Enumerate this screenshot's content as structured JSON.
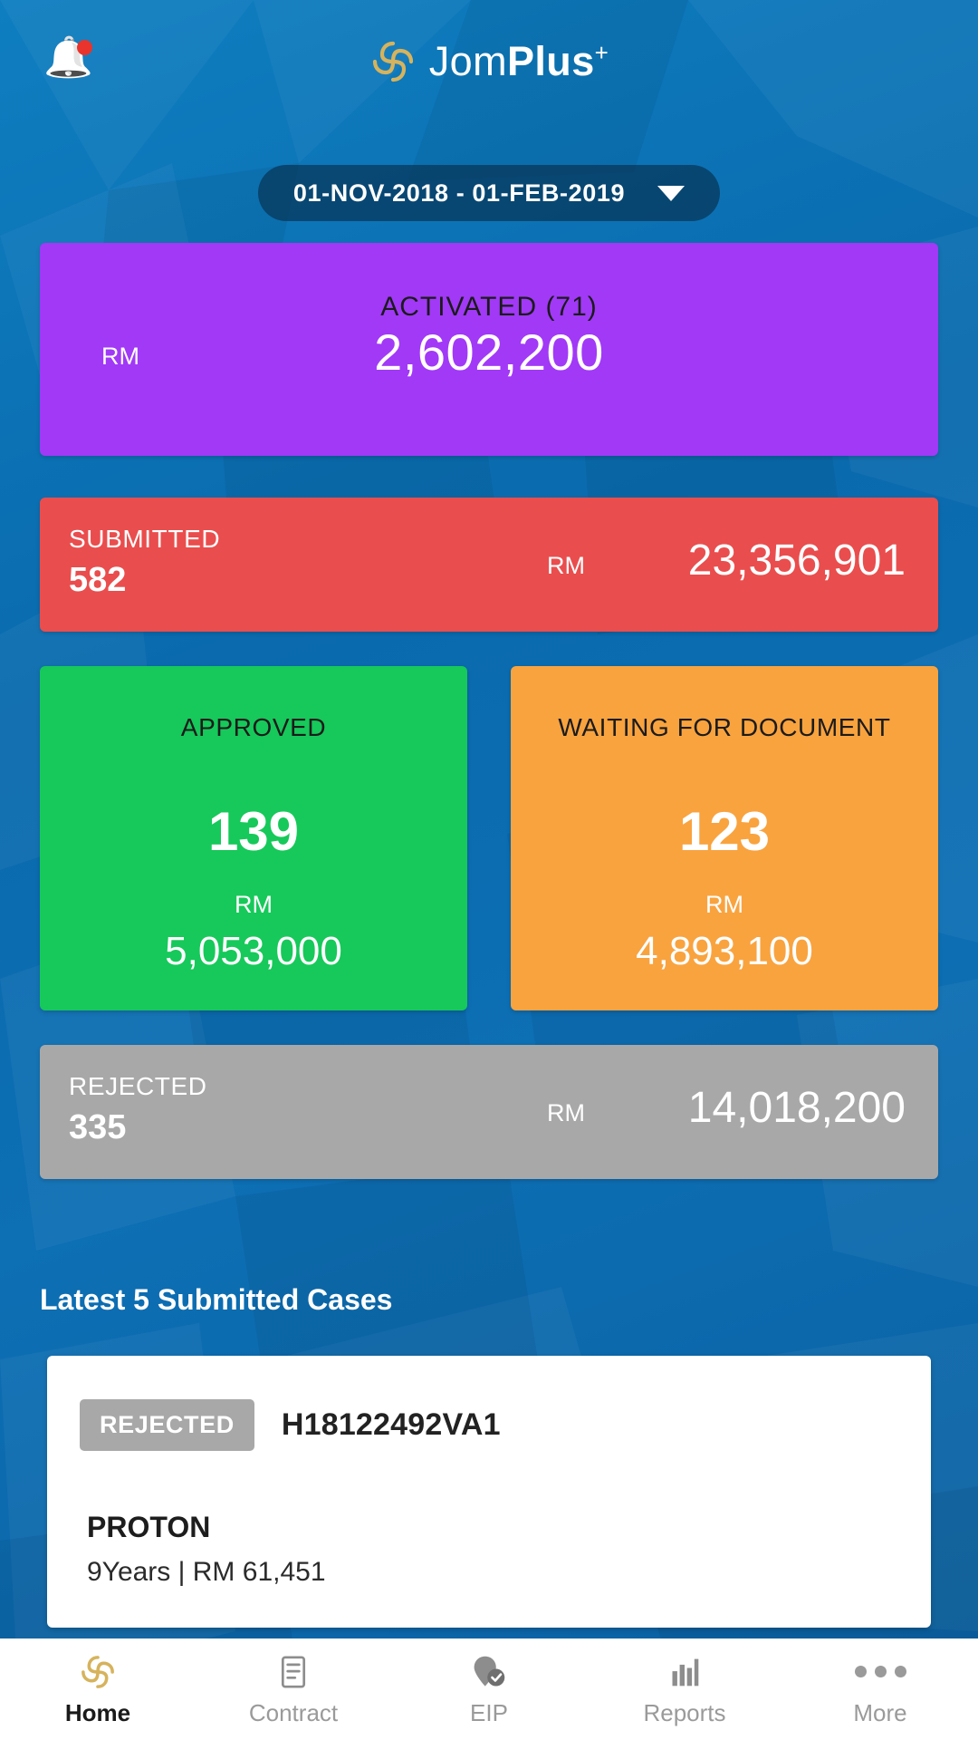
{
  "header": {
    "brand_prefix": "Jom",
    "brand_bold": "Plus",
    "brand_sup": "+",
    "notification_icon": "bell-icon",
    "logo_icon": "jomplus-logo-icon"
  },
  "date_filter": {
    "value": "01-NOV-2018 - 01-FEB-2019",
    "caret_icon": "chevron-down-icon"
  },
  "stats": {
    "activated": {
      "title": "ACTIVATED (71)",
      "currency": "RM",
      "amount": "2,602,200",
      "color": "#a139f7"
    },
    "submitted": {
      "title": "SUBMITTED",
      "count": "582",
      "currency": "RM",
      "amount": "23,356,901",
      "color": "#ea4d4d"
    },
    "approved": {
      "title": "APPROVED",
      "count": "139",
      "currency": "RM",
      "amount": "5,053,000",
      "color": "#16c95a"
    },
    "waiting": {
      "title": "WAITING FOR DOCUMENT",
      "count": "123",
      "currency": "RM",
      "amount": "4,893,100",
      "color": "#f9a33f"
    },
    "rejected": {
      "title": "REJECTED",
      "count": "335",
      "currency": "RM",
      "amount": "14,018,200",
      "color": "#a8a8a8"
    }
  },
  "latest": {
    "section_title": "Latest 5 Submitted Cases",
    "cases": [
      {
        "status": "REJECTED",
        "reference": "H18122492VA1",
        "brand": "PROTON",
        "details": "9Years | RM 61,451"
      }
    ]
  },
  "bottom_nav": {
    "items": [
      {
        "label": "Home",
        "icon": "jomplus-logo-icon",
        "active": true
      },
      {
        "label": "Contract",
        "icon": "document-icon",
        "active": false
      },
      {
        "label": "EIP",
        "icon": "location-check-icon",
        "active": false
      },
      {
        "label": "Reports",
        "icon": "bar-chart-icon",
        "active": false
      },
      {
        "label": "More",
        "icon": "ellipsis-icon",
        "active": false
      }
    ]
  }
}
